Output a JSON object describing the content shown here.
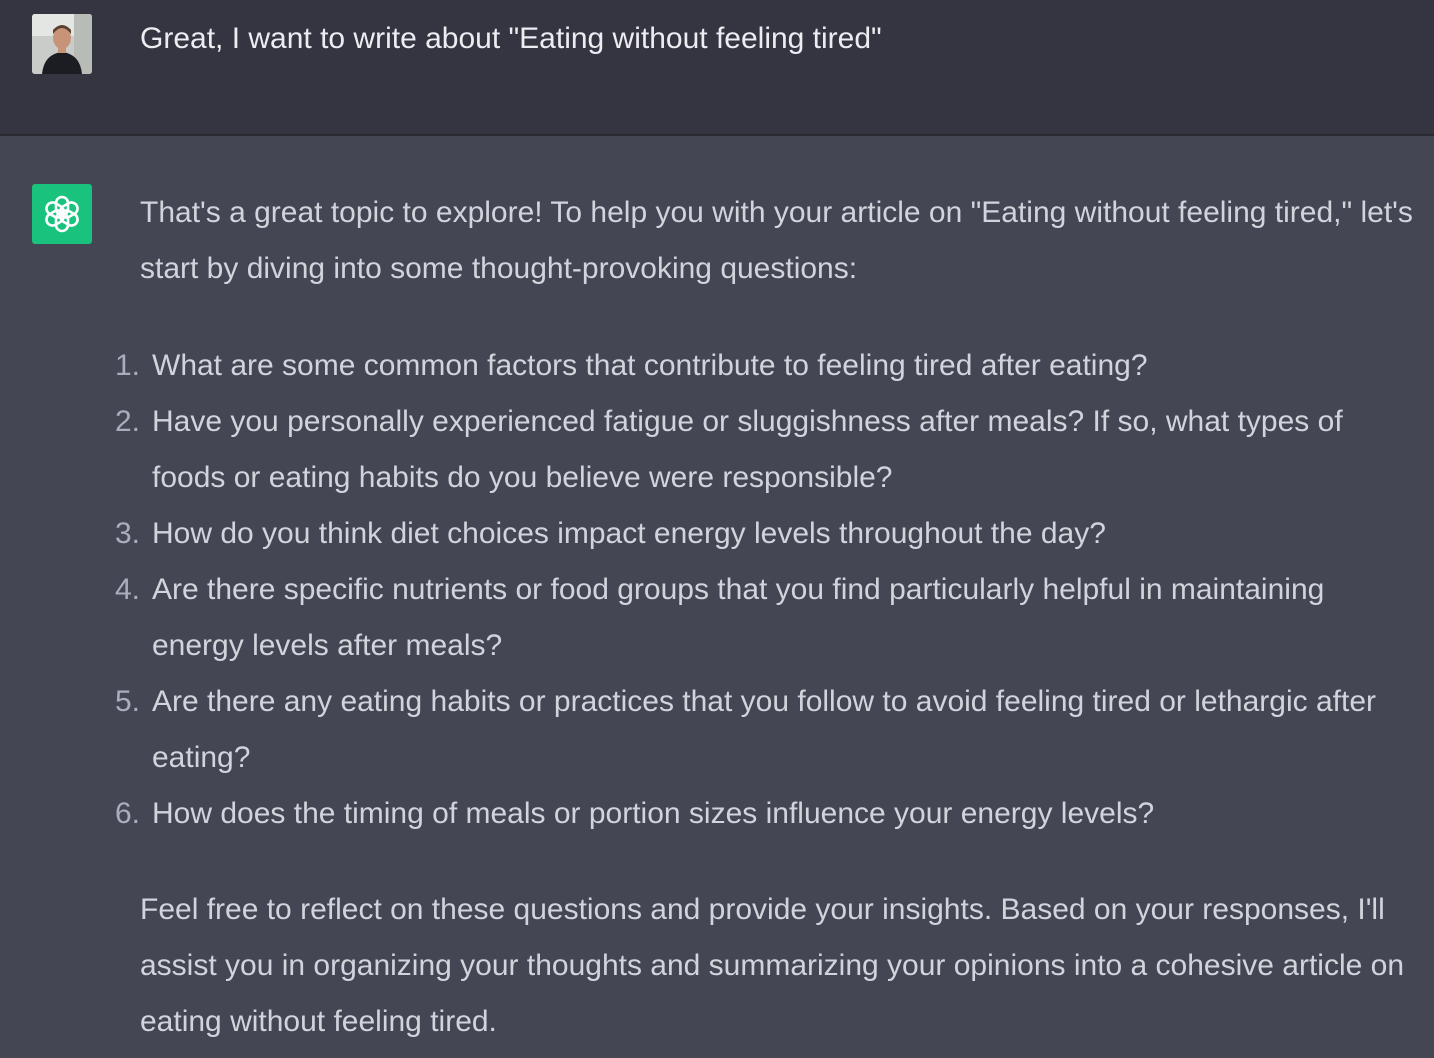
{
  "user_message": {
    "avatar_icon": "user-avatar-photo",
    "text": "Great, I want to write about \"Eating without feeling tired\""
  },
  "assistant_message": {
    "avatar_icon": "openai-logo-icon",
    "accent_color": "#19c37d",
    "intro": "That's a great topic to explore! To help you with your article on \"Eating without feeling tired,\" let's start by diving into some thought-provoking questions:",
    "questions": [
      {
        "number": "1.",
        "text": "What are some common factors that contribute to feeling tired after eating?"
      },
      {
        "number": "2.",
        "text": "Have you personally experienced fatigue or sluggishness after meals? If so, what types of foods or eating habits do you believe were responsible?"
      },
      {
        "number": "3.",
        "text": "How do you think diet choices impact energy levels throughout the day?"
      },
      {
        "number": "4.",
        "text": "Are there specific nutrients or food groups that you find particularly helpful in maintaining energy levels after meals?"
      },
      {
        "number": "5.",
        "text": "Are there any eating habits or practices that you follow to avoid feeling tired or lethargic after eating?"
      },
      {
        "number": "6.",
        "text": "How does the timing of meals or portion sizes influence your energy levels?"
      }
    ],
    "outro": "Feel free to reflect on these questions and provide your insights. Based on your responses, I'll assist you in organizing your thoughts and summarizing your opinions into a cohesive article on eating without feeling tired."
  }
}
